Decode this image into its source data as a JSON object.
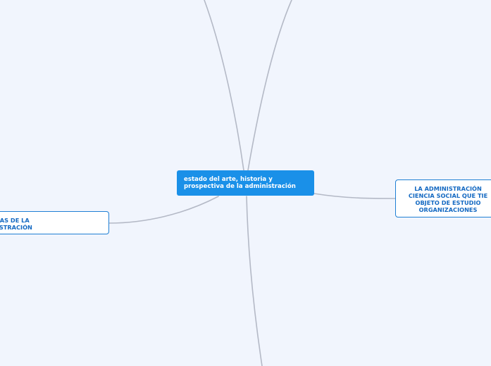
{
  "central_topic": {
    "line1": "estado del arte, historia y",
    "line2": "prospectiva de la administración"
  },
  "topics": {
    "left": {
      "line1": "ELAS DE LA",
      "line2": "NISTRACIÓN"
    },
    "right": {
      "line1": "LA ADMINISTRACIÓN",
      "line2": "CIENCIA SOCIAL QUE TIE",
      "line3": "OBJETO DE ESTUDIO",
      "line4": "ORGANIZACIONES"
    }
  },
  "colors": {
    "background": "#f1f5fd",
    "central_fill": "#1a90e8",
    "topic_border": "#1f7fd4",
    "topic_text": "#1469c2",
    "connector": "#b4b9c6"
  }
}
